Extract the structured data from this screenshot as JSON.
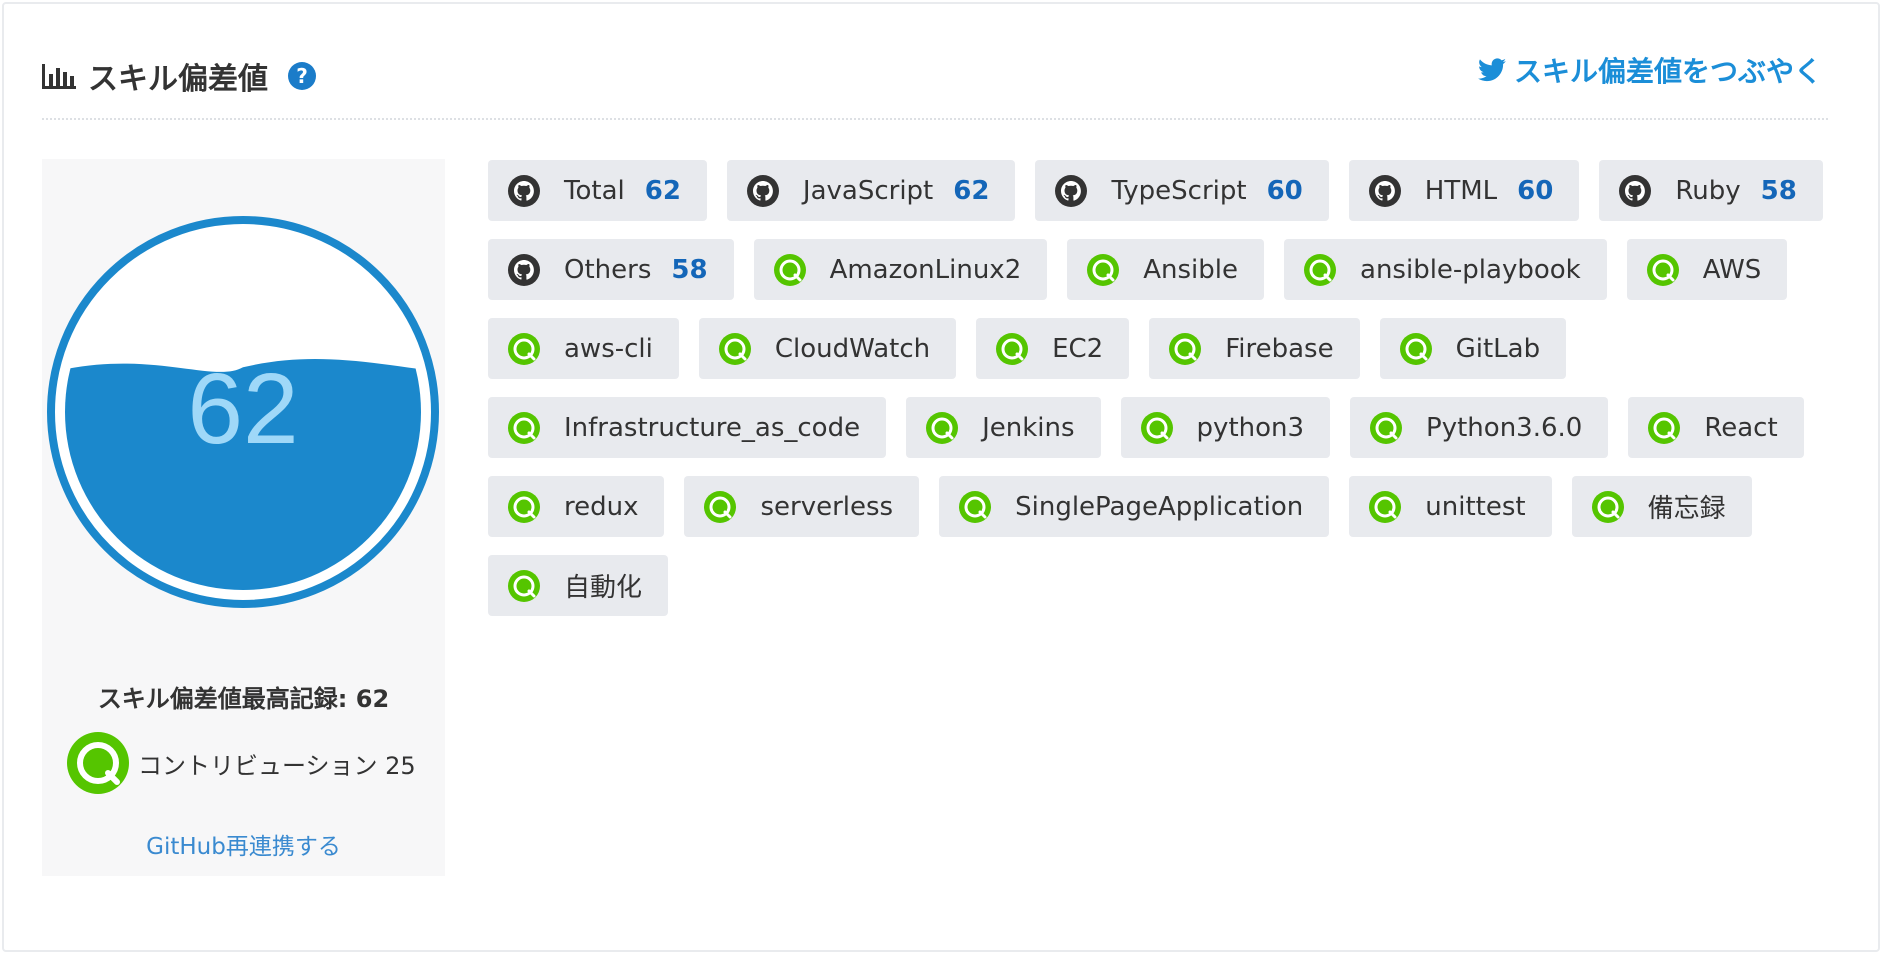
{
  "header": {
    "title": "スキル偏差値",
    "help": "?",
    "tweet_label": "スキル偏差値をつぶやく"
  },
  "sidebar": {
    "gauge_value": "62",
    "gauge_level_percent": 62,
    "record_label": "スキル偏差値最高記録: 62",
    "contribution_label": "コントリビューション 25",
    "relink_label": "GitHub再連携する"
  },
  "tags": [
    {
      "label": "Total",
      "score": "62",
      "icon": "github-icon"
    },
    {
      "label": "JavaScript",
      "score": "62",
      "icon": "github-icon"
    },
    {
      "label": "TypeScript",
      "score": "60",
      "icon": "github-icon"
    },
    {
      "label": "HTML",
      "score": "60",
      "icon": "github-icon"
    },
    {
      "label": "Ruby",
      "score": "58",
      "icon": "github-icon"
    },
    {
      "label": "Others",
      "score": "58",
      "icon": "github-icon"
    },
    {
      "label": "AmazonLinux2",
      "icon": "qiita-icon"
    },
    {
      "label": "Ansible",
      "icon": "qiita-icon"
    },
    {
      "label": "ansible-playbook",
      "icon": "qiita-icon"
    },
    {
      "label": "AWS",
      "icon": "qiita-icon"
    },
    {
      "label": "aws-cli",
      "icon": "qiita-icon"
    },
    {
      "label": "CloudWatch",
      "icon": "qiita-icon"
    },
    {
      "label": "EC2",
      "icon": "qiita-icon"
    },
    {
      "label": "Firebase",
      "icon": "qiita-icon"
    },
    {
      "label": "GitLab",
      "icon": "qiita-icon"
    },
    {
      "label": "Infrastructure_as_code",
      "icon": "qiita-icon"
    },
    {
      "label": "Jenkins",
      "icon": "qiita-icon"
    },
    {
      "label": "python3",
      "icon": "qiita-icon"
    },
    {
      "label": "Python3.6.0",
      "icon": "qiita-icon"
    },
    {
      "label": "React",
      "icon": "qiita-icon"
    },
    {
      "label": "redux",
      "icon": "qiita-icon"
    },
    {
      "label": "serverless",
      "icon": "qiita-icon"
    },
    {
      "label": "SinglePageApplication",
      "icon": "qiita-icon"
    },
    {
      "label": "unittest",
      "icon": "qiita-icon"
    },
    {
      "label": "備忘録",
      "icon": "qiita-icon"
    },
    {
      "label": "自動化",
      "icon": "qiita-icon"
    }
  ],
  "colors": {
    "accent": "#1b8ed8",
    "gauge_water": "#1b88cc",
    "gauge_text": "#9fd8f8",
    "qiita_green": "#55c500",
    "score_blue": "#1466b8"
  }
}
